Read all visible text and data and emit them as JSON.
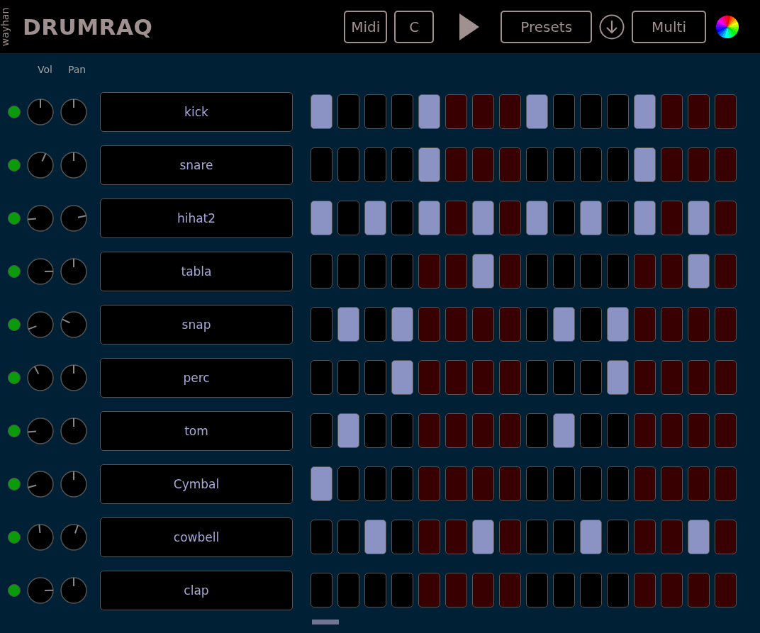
{
  "header": {
    "vendor": "wayhan",
    "title": "DRUMRAQ",
    "buttons": [
      {
        "kind": "text",
        "label": "Midi"
      },
      {
        "kind": "text",
        "label": "C"
      },
      {
        "kind": "play"
      },
      {
        "kind": "text",
        "label": "Presets"
      },
      {
        "kind": "download"
      },
      {
        "kind": "text",
        "label": "Multi"
      },
      {
        "kind": "color"
      }
    ]
  },
  "columns": {
    "vol": "Vol",
    "pan": "Pan"
  },
  "tracks": [
    {
      "name": "kick",
      "on": true,
      "vol": {
        "level": 0.5
      },
      "pan": {
        "level": 0.5
      },
      "steps": [
        true,
        false,
        false,
        false,
        true,
        false,
        false,
        false,
        true,
        false,
        false,
        false,
        true,
        false,
        false,
        false
      ]
    },
    {
      "name": "snare",
      "on": true,
      "vol": {
        "level": 0.59
      },
      "pan": {
        "level": 0.5
      },
      "steps": [
        false,
        false,
        false,
        false,
        true,
        false,
        false,
        false,
        false,
        false,
        false,
        false,
        true,
        false,
        false,
        false
      ]
    },
    {
      "name": "hihat2",
      "on": true,
      "vol": {
        "level": 0.15
      },
      "pan": {
        "level": 0.79
      },
      "steps": [
        true,
        false,
        true,
        false,
        true,
        false,
        true,
        false,
        true,
        false,
        true,
        false,
        true,
        false,
        true,
        false
      ]
    },
    {
      "name": "tabla",
      "on": true,
      "vol": {
        "level": 0.83
      },
      "pan": {
        "level": 0.5
      },
      "steps": [
        false,
        false,
        false,
        false,
        false,
        false,
        true,
        false,
        false,
        false,
        false,
        false,
        false,
        false,
        true,
        false
      ]
    },
    {
      "name": "snap",
      "on": true,
      "vol": {
        "level": 0.09
      },
      "pan": {
        "level": 0.26
      },
      "steps": [
        false,
        true,
        false,
        true,
        false,
        false,
        false,
        false,
        false,
        true,
        false,
        true,
        false,
        false,
        false,
        false
      ]
    },
    {
      "name": "perc",
      "on": true,
      "vol": {
        "level": 0.4
      },
      "pan": {
        "level": 0.5
      },
      "steps": [
        false,
        false,
        false,
        true,
        false,
        false,
        false,
        false,
        false,
        false,
        false,
        true,
        false,
        false,
        false,
        false
      ]
    },
    {
      "name": "tom",
      "on": true,
      "vol": {
        "level": 0.15
      },
      "pan": {
        "level": 0.5
      },
      "steps": [
        false,
        true,
        false,
        false,
        false,
        false,
        false,
        false,
        false,
        true,
        false,
        false,
        false,
        false,
        false,
        false
      ]
    },
    {
      "name": "Cymbal",
      "on": true,
      "vol": {
        "level": 0.11
      },
      "pan": {
        "level": 0.5
      },
      "steps": [
        true,
        false,
        false,
        false,
        false,
        false,
        false,
        false,
        false,
        false,
        false,
        false,
        false,
        false,
        false,
        false
      ]
    },
    {
      "name": "cowbell",
      "on": true,
      "vol": {
        "level": 0.48
      },
      "pan": {
        "level": 0.57
      },
      "steps": [
        false,
        false,
        true,
        false,
        false,
        false,
        true,
        false,
        false,
        false,
        true,
        false,
        false,
        false,
        true,
        false
      ]
    },
    {
      "name": "clap",
      "on": true,
      "vol": {
        "level": 0.83
      },
      "pan": {
        "level": 0.5
      },
      "steps": [
        false,
        false,
        false,
        false,
        false,
        false,
        false,
        false,
        false,
        false,
        false,
        false,
        false,
        false,
        false,
        false
      ]
    }
  ]
}
